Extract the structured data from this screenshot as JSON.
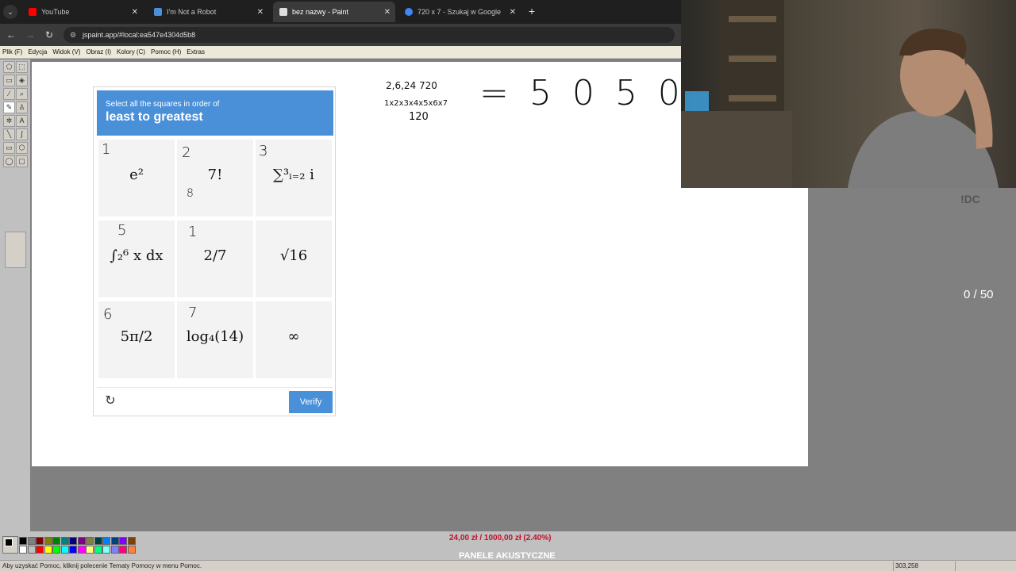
{
  "browser": {
    "tabs": [
      {
        "title": "YouTube",
        "favicon_color": "#ff0000",
        "active": false
      },
      {
        "title": "I'm Not a Robot",
        "favicon_color": "#4a90d9",
        "active": false
      },
      {
        "title": "bez nazwy - Paint",
        "favicon_color": "#dddddd",
        "active": true
      },
      {
        "title": "720 x 7 - Szukaj w Google",
        "favicon_color": "#4285f4",
        "active": false
      }
    ],
    "new_tab_icon": "+",
    "url": "jspaint.app/#local:ea547e4304d5b8"
  },
  "paint": {
    "menu": [
      "Plik (F)",
      "Edycja",
      "Widok (V)",
      "Obraz (I)",
      "Kolory (C)",
      "Pomoc (H)",
      "Extras"
    ],
    "status_help": "Aby uzyskać Pomoc, kliknij polecenie Tematy Pomocy w menu Pomoc.",
    "status_coords": "303,258",
    "palette_colors": [
      "#000000",
      "#808080",
      "#800000",
      "#808000",
      "#008000",
      "#008080",
      "#000080",
      "#800080",
      "#808040",
      "#004040",
      "#0080ff",
      "#004080",
      "#8000ff",
      "#804000",
      "#ffffff",
      "#c0c0c0",
      "#ff0000",
      "#ffff00",
      "#00ff00",
      "#00ffff",
      "#0000ff",
      "#ff00ff",
      "#ffff80",
      "#00ff80",
      "#80ffff",
      "#8080ff",
      "#ff0080",
      "#ff8040"
    ]
  },
  "captcha": {
    "instruction": "Select all the squares in order of",
    "emphasis": "least to greatest",
    "cells": [
      {
        "expr": "e²",
        "mark": "1"
      },
      {
        "expr": "7!",
        "mark": "2",
        "mark2": "8"
      },
      {
        "expr": "∑³ᵢ₌₂ i",
        "mark": "3"
      },
      {
        "expr": "∫₂⁶ x dx",
        "mark": "5"
      },
      {
        "expr": "2/7",
        "mark": "1"
      },
      {
        "expr": "√16",
        "mark": ""
      },
      {
        "expr": "5π/2",
        "mark": "6"
      },
      {
        "expr": "log₄(14)",
        "mark": "7"
      },
      {
        "expr": "∞",
        "mark": ""
      }
    ],
    "refresh_icon": "↻",
    "verify_label": "Verify"
  },
  "scribbles": {
    "top": "2,6,24 720",
    "middle": "1x2x3x4x5x6x7",
    "bottom": "120",
    "big": "= 5 0 5 0"
  },
  "overlay": {
    "discord_tag": "!DC",
    "counter": "0 / 50",
    "donation": "24,00 zł / 1000,00 zł (2.40%)",
    "product": "PANELE AKUSTYCZNE"
  }
}
